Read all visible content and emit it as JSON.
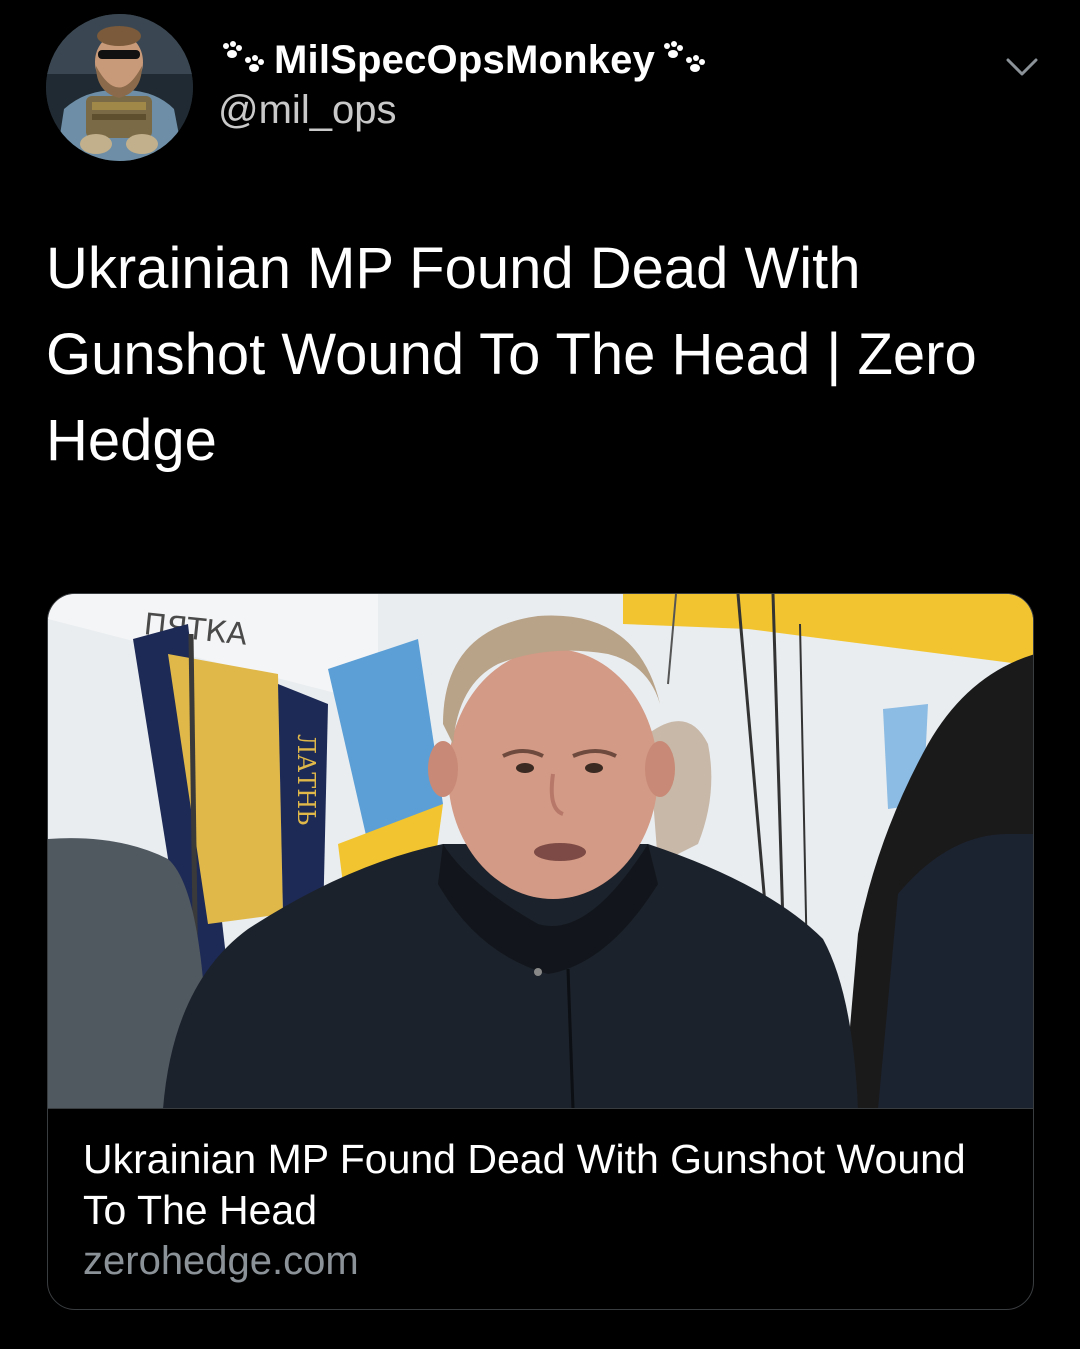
{
  "user": {
    "display_name": "MilSpecOpsMonkey",
    "handle": "@mil_ops",
    "avatar_icon": "profile-avatar",
    "name_decoration_icon": "paw-prints-icon"
  },
  "menu_icon": "chevron-down-icon",
  "tweet": {
    "text": "Ukrainian MP Found Dead With Gunshot Wound To The Head | Zero Hedge"
  },
  "card": {
    "image_text": [
      "ПЯТКА",
      "ЛАТНЬ"
    ],
    "title": "Ukrainian MP Found Dead With Gunshot Wound To The Head",
    "domain": "zerohedge.com"
  },
  "colors": {
    "background": "#000000",
    "text": "#ffffff",
    "handle": "#c9c9c9",
    "card_border": "#3a3d40",
    "domain": "#8b9298",
    "flag_blue": "#5b9fd6",
    "flag_yellow": "#f2c530"
  }
}
